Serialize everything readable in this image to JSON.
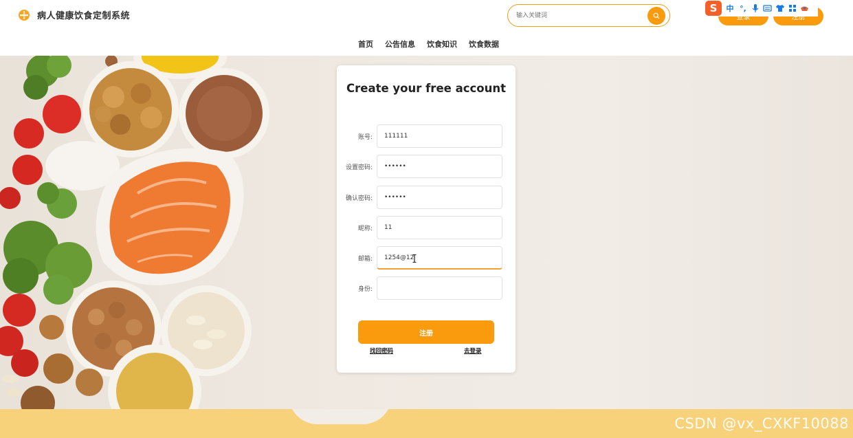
{
  "header": {
    "site_title": "病人健康饮食定制系统",
    "search_placeholder": "输入关键词",
    "login_label": "登录",
    "register_label": "注册"
  },
  "ime": {
    "brand": "S",
    "mode": "中",
    "items": [
      "°,",
      "mic-icon",
      "keyboard-icon",
      "shirt-icon",
      "grid-icon",
      "toolbox-icon"
    ]
  },
  "nav": {
    "items": [
      "首页",
      "公告信息",
      "饮食知识",
      "饮食数据"
    ]
  },
  "form": {
    "title": "Create your free account",
    "fields": [
      {
        "label": "账号:",
        "value": "111111"
      },
      {
        "label": "设置密码:",
        "value": "••••••"
      },
      {
        "label": "确认密码:",
        "value": "••••••"
      },
      {
        "label": "昵称:",
        "value": "11"
      },
      {
        "label": "邮箱:",
        "value": "1254@12"
      },
      {
        "label": "身份:",
        "value": ""
      }
    ],
    "submit_label": "注册",
    "forgot_label": "找回密码",
    "goto_login_label": "去登录"
  },
  "watermark": "CSDN @vx_CXKF10088",
  "colors": {
    "accent": "#f99b0c",
    "footer": "#f7d27a"
  }
}
